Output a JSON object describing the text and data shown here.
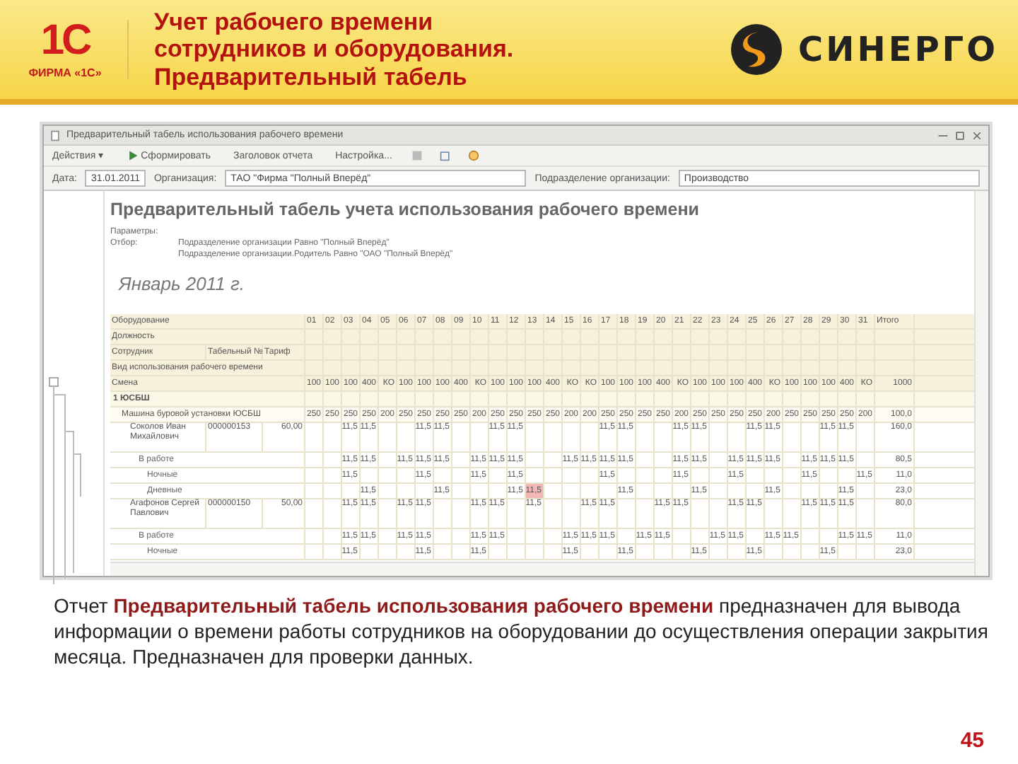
{
  "slide": {
    "logo_caption": "ФИРМА «1С»",
    "logo_mark": "1С",
    "title": "Учет рабочего времени сотрудников и оборудования. Предварительный табель",
    "partner": "СИНЕРГО"
  },
  "window": {
    "title": "Предварительный табель использования рабочего времени",
    "toolbar": [
      {
        "label": "Действия ▾",
        "kind": "menu"
      },
      {
        "label": "Сформировать",
        "kind": "run"
      },
      {
        "label": "Заголовок отчета",
        "kind": "text"
      },
      {
        "label": "Настройка...",
        "kind": "text"
      }
    ],
    "filters": [
      {
        "label": "Дата:",
        "value": "31.01.2011"
      },
      {
        "label": "Организация:",
        "value": "ТАО \"Фирма \"Полный Вперёд\""
      },
      {
        "label": "Подразделение организации:",
        "value": "Производство"
      }
    ],
    "report": {
      "title": "Предварительный табель учета использования рабочего времени",
      "params": [
        {
          "label": "Параметры:"
        },
        {
          "label": "Отбор:",
          "text": "Подразделение организации Равно \"Полный Вперёд\""
        },
        {
          "text": "Подразделение организации.Родитель Равно \"ОАО \"Полный Вперёд\""
        }
      ],
      "period": "Январь 2011 г.",
      "header_rows": [
        {
          "labels": [
            "Оборудование"
          ],
          "cells": [
            "01",
            "02",
            "03",
            "04",
            "05",
            "06",
            "07",
            "08",
            "09",
            "10",
            "11",
            "12",
            "13",
            "14",
            "15",
            "16",
            "17",
            "18",
            "19",
            "20",
            "21",
            "22",
            "23",
            "24",
            "25",
            "26",
            "27",
            "28",
            "29",
            "30",
            "31",
            "Итого"
          ]
        },
        {
          "labels": [
            "Должность"
          ]
        },
        {
          "labels": [
            "Сотрудник",
            "Табельный №",
            "Тариф"
          ]
        },
        {
          "labels": [
            "Вид использования рабочего времени"
          ]
        }
      ],
      "shift": {
        "label": "Смена",
        "cells": [
          "100",
          "100",
          "100",
          "400",
          "КО",
          "100",
          "100",
          "100",
          "400",
          "КО",
          "100",
          "100",
          "100",
          "400",
          "КО",
          "КО",
          "100",
          "100",
          "100",
          "400",
          "КО",
          "100",
          "100",
          "100",
          "400",
          "КО",
          "100",
          "100",
          "100",
          "400",
          "КО",
          "1000"
        ]
      },
      "rows": [
        {
          "kind": "group",
          "label": "1 ЮСБШ",
          "cells": [],
          "children": [
            {
              "kind": "machine",
              "label": "Машина буровой установки ЮСБШ",
              "cells": [
                "250",
                "250",
                "250",
                "250",
                "200",
                "250",
                "250",
                "250",
                "250",
                "200",
                "250",
                "250",
                "250",
                "250",
                "200",
                "200",
                "250",
                "250",
                "250",
                "250",
                "200",
                "250",
                "250",
                "250",
                "250",
                "200",
                "250",
                "250",
                "250",
                "250",
                "200",
                "100,0"
              ],
              "children": [
                {
                  "kind": "employee",
                  "label": "Соколов Иван Михайлович",
                  "number": "000000153",
                  "rate": "60,00",
                  "cells": [
                    null,
                    null,
                    "11,5",
                    "11,5",
                    null,
                    null,
                    "11,5",
                    "11,5",
                    null,
                    null,
                    "11,5",
                    "11,5",
                    null,
                    null,
                    null,
                    null,
                    "11,5",
                    "11,5",
                    null,
                    null,
                    "11,5",
                    "11,5",
                    null,
                    null,
                    "11,5",
                    "11,5",
                    null,
                    null,
                    "11,5",
                    "11,5",
                    null,
                    "160,0"
                  ],
                  "children": [
                    {
                      "kind": "detail",
                      "label": "В работе",
                      "cells": [
                        null,
                        null,
                        "11,5",
                        "11,5",
                        null,
                        "11,5",
                        "11,5",
                        "11,5",
                        null,
                        "11,5",
                        "11,5",
                        "11,5",
                        null,
                        null,
                        "11,5",
                        "11,5",
                        "11,5",
                        "11,5",
                        null,
                        null,
                        "11,5",
                        "11,5",
                        null,
                        "11,5",
                        "11,5",
                        "11,5",
                        null,
                        "11,5",
                        "11,5",
                        "11,5",
                        null,
                        "80,5"
                      ],
                      "children": [
                        {
                          "kind": "detail",
                          "label": "Ночные",
                          "cells": [
                            null,
                            null,
                            "11,5",
                            null,
                            null,
                            null,
                            "11,5",
                            null,
                            null,
                            "11,5",
                            null,
                            "11,5",
                            null,
                            null,
                            null,
                            null,
                            "11,5",
                            null,
                            null,
                            null,
                            "11,5",
                            null,
                            null,
                            "11,5",
                            null,
                            null,
                            null,
                            "11,5",
                            null,
                            null,
                            "11,5",
                            "11,0"
                          ]
                        },
                        {
                          "kind": "detail",
                          "label": "Дневные",
                          "cells": [
                            null,
                            null,
                            null,
                            "11,5",
                            null,
                            null,
                            null,
                            "11,5",
                            null,
                            null,
                            null,
                            "11,5",
                            {
                              "text": "11,5",
                              "flagged": true
                            },
                            null,
                            null,
                            null,
                            null,
                            "11,5",
                            null,
                            null,
                            null,
                            "11,5",
                            null,
                            null,
                            null,
                            "11,5",
                            null,
                            null,
                            null,
                            "11,5",
                            null,
                            "23,0"
                          ]
                        }
                      ]
                    }
                  ]
                },
                {
                  "kind": "employee",
                  "label": "Агафонов Сергей Павлович",
                  "number": "000000150",
                  "rate": "50,00",
                  "cells": [
                    null,
                    null,
                    "11,5",
                    "11,5",
                    null,
                    "11,5",
                    "11,5",
                    null,
                    null,
                    "11,5",
                    "11,5",
                    null,
                    "11,5",
                    null,
                    null,
                    "11,5",
                    "11,5",
                    null,
                    null,
                    "11,5",
                    "11,5",
                    null,
                    null,
                    "11,5",
                    "11,5",
                    null,
                    null,
                    "11,5",
                    "11,5",
                    "11,5",
                    null,
                    "80,0"
                  ],
                  "children": [
                    {
                      "kind": "detail",
                      "label": "В работе",
                      "cells": [
                        null,
                        null,
                        "11,5",
                        "11,5",
                        null,
                        "11,5",
                        "11,5",
                        null,
                        null,
                        "11,5",
                        "11,5",
                        null,
                        null,
                        null,
                        "11,5",
                        "11,5",
                        "11,5",
                        null,
                        "11,5",
                        "11,5",
                        null,
                        null,
                        "11,5",
                        "11,5",
                        null,
                        "11,5",
                        "11,5",
                        null,
                        null,
                        "11,5",
                        "11,5",
                        "11,0"
                      ],
                      "children": [
                        {
                          "kind": "detail",
                          "label": "Ночные",
                          "cells": [
                            null,
                            null,
                            "11,5",
                            null,
                            null,
                            null,
                            "11,5",
                            null,
                            null,
                            "11,5",
                            null,
                            null,
                            null,
                            null,
                            "11,5",
                            null,
                            null,
                            "11,5",
                            null,
                            null,
                            null,
                            "11,5",
                            null,
                            null,
                            "11,5",
                            null,
                            null,
                            null,
                            "11,5",
                            null,
                            null,
                            "23,0"
                          ]
                        }
                      ]
                    }
                  ]
                }
              ]
            }
          ]
        }
      ]
    }
  },
  "caption": "Отчет **Предварительный табель использования рабочего времени** предназначен для вывода информации о времени работы сотрудников на оборудовании до осуществления операции закрытия месяца. Предназначен для проверки данных.",
  "page_number": "45"
}
